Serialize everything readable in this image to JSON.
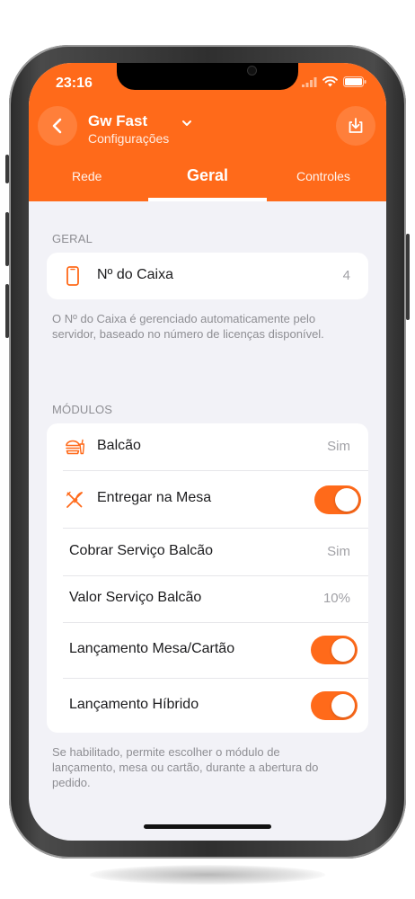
{
  "status_bar": {
    "time": "23:16"
  },
  "header": {
    "title": "Gw Fast",
    "subtitle": "Configurações",
    "back_icon": "chevron-left-icon",
    "download_icon": "download-icon"
  },
  "tabs": [
    {
      "label": "Rede",
      "active": false
    },
    {
      "label": "Geral",
      "active": true
    },
    {
      "label": "Controles",
      "active": false
    }
  ],
  "geral": {
    "section_label": "GERAL",
    "rows": [
      {
        "label": "Nº do Caixa",
        "value": "4",
        "icon": "phone-icon"
      }
    ],
    "note": "O Nº do Caixa é gerenciado automaticamente pelo servidor, baseado no número de licenças disponível."
  },
  "modulos": {
    "section_label": "MÓDULOS",
    "rows": [
      {
        "label": "Balcão",
        "value": "Sim",
        "icon": "burger-icon"
      },
      {
        "label": "Entregar na Mesa",
        "toggle": true,
        "icon": "cutlery-icon"
      },
      {
        "label": "Cobrar Serviço Balcão",
        "value": "Sim"
      },
      {
        "label": "Valor Serviço Balcão",
        "value": "10%"
      },
      {
        "label": "Lançamento Mesa/Cartão",
        "toggle": true
      },
      {
        "label": "Lançamento Híbrido",
        "toggle": true
      }
    ],
    "note": "Se habilitado, permite escolher o módulo de lançamento, mesa ou cartão, durante a abertura do pedido."
  },
  "colors": {
    "accent": "#ff6a1a",
    "background": "#f2f2f7",
    "secondary_text": "#8e8e93"
  }
}
